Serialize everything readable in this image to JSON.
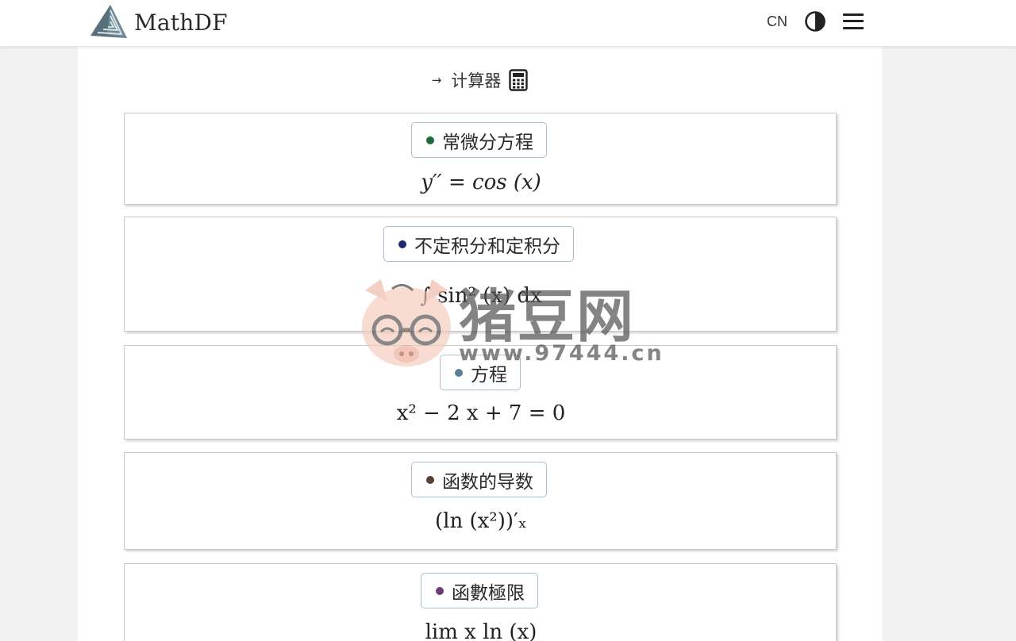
{
  "header": {
    "logo_text": "MathDF",
    "language": "CN",
    "theme_icon": "contrast-icon",
    "menu_icon": "hamburger-menu-icon"
  },
  "calculator_link": {
    "arrow": "→",
    "label": "计算器",
    "icon": "calculator-icon"
  },
  "cards": [
    {
      "label": "常微分方程",
      "dot_color": "#1e6b3a",
      "formula": "y′′ = cos (x)"
    },
    {
      "label": "不定积分和定积分",
      "dot_color": "#1f2a68",
      "formula": "∫ sin² (x) dx"
    },
    {
      "label": "方程",
      "dot_color": "#5d7f98",
      "formula": "x² − 2 x + 7 = 0"
    },
    {
      "label": "函数的导数",
      "dot_color": "#5a4030",
      "formula": "(ln (x²))′ₓ"
    },
    {
      "label": "函數極限",
      "dot_color": "#6e3a78",
      "formula": "lim x ln (x)"
    }
  ],
  "watermark": {
    "title": "猪豆网",
    "url": "www.97444.cn"
  }
}
